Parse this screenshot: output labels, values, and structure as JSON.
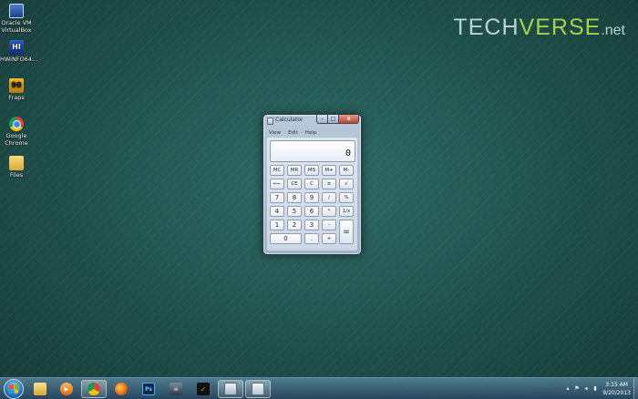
{
  "watermark": {
    "part1": "TECH",
    "part2": "VERSE",
    "part3": ".net"
  },
  "desktop_icons": [
    {
      "label": "Oracle VM VirtualBox",
      "icon": "virtualbox-icon"
    },
    {
      "label": "HWiNFO64...",
      "icon": "hwinfo-icon"
    },
    {
      "label": "Fraps",
      "icon": "fraps-icon"
    },
    {
      "label": "Google Chrome",
      "icon": "chrome-icon"
    },
    {
      "label": "Files",
      "icon": "folder-icon"
    }
  ],
  "calculator": {
    "title": "Calculator",
    "window_buttons": {
      "minimize": "–",
      "maximize": "□",
      "close": "x"
    },
    "menu": [
      "View",
      "Edit",
      "Help"
    ],
    "display": "0",
    "keys": {
      "mc": "MC",
      "mr": "MR",
      "ms": "MS",
      "mplus": "M+",
      "mminus": "M-",
      "back": "⟵",
      "ce": "CE",
      "c": "C",
      "plusminus": "±",
      "sqrt": "√",
      "seven": "7",
      "eight": "8",
      "nine": "9",
      "divide": "/",
      "percent": "%",
      "four": "4",
      "five": "5",
      "six": "6",
      "multiply": "*",
      "reciprocal": "1/x",
      "one": "1",
      "two": "2",
      "three": "3",
      "minus": "-",
      "equals": "=",
      "zero": "0",
      "dot": ".",
      "plus": "+"
    }
  },
  "taskbar": {
    "pinned": [
      "explorer",
      "media-player",
      "chrome",
      "firefox",
      "photoshop",
      "game",
      "nvidia",
      "calculator",
      "files"
    ],
    "active": "calculator",
    "tray_icons": [
      "arrow-up-icon",
      "flag-icon",
      "speaker-icon",
      "network-icon"
    ],
    "clock": {
      "time": "3:15 AM",
      "date": "9/20/2013"
    }
  }
}
